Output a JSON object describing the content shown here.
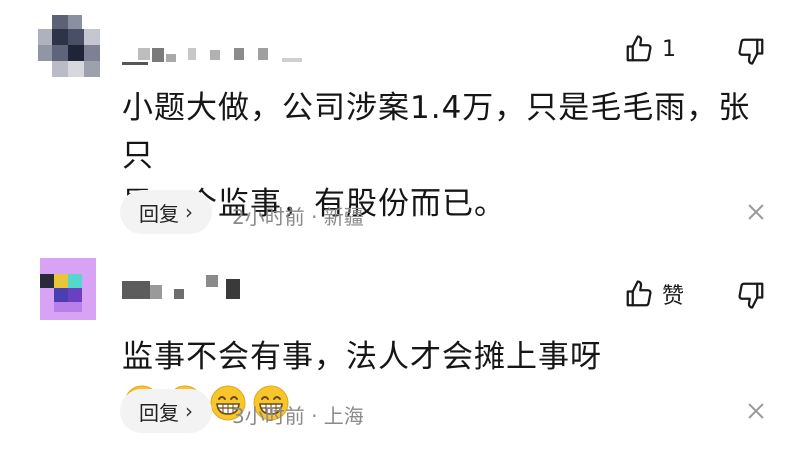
{
  "comments": [
    {
      "like_count": "1",
      "text_line1": "小题大做，公司涉案1.4万，只是毛毛雨，张只",
      "text_line2": "是一个监事，有股份而已。",
      "reply_label": "回复",
      "meta": "2小时前 · 新疆"
    },
    {
      "like_label": "赞",
      "text": "监事不会有事，法人才会摊上事呀",
      "emoji_count": 4,
      "reply_label": "回复",
      "meta": "3小时前 · 上海"
    }
  ],
  "icons": {
    "like": "thumb-up-icon",
    "dislike": "thumb-down-icon",
    "close": "close-icon",
    "reply_chevron": "chevron-right-icon",
    "emoji": "grinning-face-emoji"
  },
  "colors": {
    "text": "#161616",
    "meta": "#8a8a8a",
    "reply_bg": "#f3f3f3",
    "avatar2_bg": "#d9a3f5"
  }
}
